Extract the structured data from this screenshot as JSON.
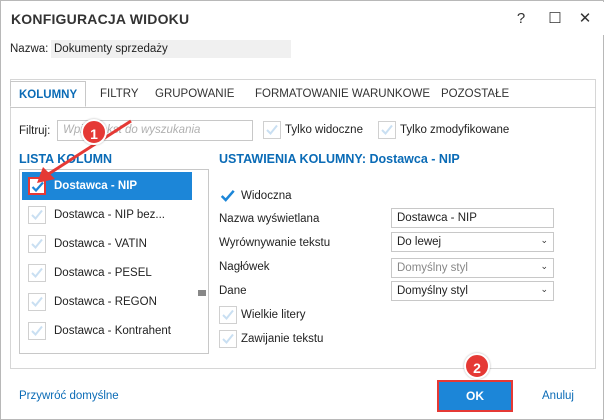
{
  "window": {
    "title": "KONFIGURACJA WIDOKU",
    "help_label": "?",
    "maximize_label": "☐",
    "close_label": "✕"
  },
  "name": {
    "label": "Nazwa:",
    "value": "Dokumenty sprzedaży"
  },
  "tabs": [
    {
      "label": "KOLUMNY",
      "active": true
    },
    {
      "label": "FILTRY"
    },
    {
      "label": "GRUPOWANIE"
    },
    {
      "label": "FORMATOWANIE WARUNKOWE"
    },
    {
      "label": "POZOSTAŁE"
    }
  ],
  "filter": {
    "label": "Filtruj:",
    "placeholder": "Wpisz tekst do wyszukania",
    "only_visible": "Tylko widoczne",
    "only_modified": "Tylko zmodyfikowane"
  },
  "columns_list": {
    "title": "LISTA KOLUMN",
    "items": [
      {
        "label": "Dostawca - NIP",
        "selected": true
      },
      {
        "label": "Dostawca - NIP bez..."
      },
      {
        "label": "Dostawca - VATIN"
      },
      {
        "label": "Dostawca - PESEL"
      },
      {
        "label": "Dostawca - REGON"
      },
      {
        "label": "Dostawca - Kontrahent"
      }
    ]
  },
  "settings": {
    "title": "USTAWIENIA KOLUMNY: Dostawca - NIP",
    "visible_label": "Widoczna",
    "display_name_label": "Nazwa wyświetlana",
    "display_name_value": "Dostawca - NIP",
    "align_label": "Wyrównywanie tekstu",
    "align_value": "Do lewej",
    "header_label": "Nagłówek",
    "header_value": "Domyślny styl",
    "data_label": "Dane",
    "data_value": "Domyślny styl",
    "uppercase_label": "Wielkie litery",
    "wrap_label": "Zawijanie tekstu"
  },
  "footer": {
    "restore_label": "Przywróć domyślne",
    "ok_label": "OK",
    "cancel_label": "Anuluj"
  },
  "annotations": {
    "badge_1": "1",
    "badge_2": "2"
  },
  "colors": {
    "accent": "#1c86d8",
    "heading": "#0a6bb6",
    "highlight": "#e53935"
  }
}
